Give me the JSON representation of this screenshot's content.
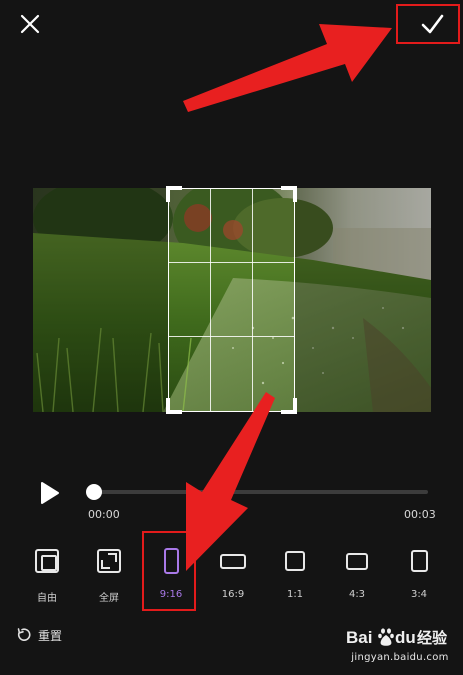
{
  "toolbar": {
    "close_icon": "close-icon",
    "confirm_icon": "check-icon"
  },
  "playback": {
    "start_time": "00:00",
    "end_time": "00:03",
    "progress": 0.0,
    "play_icon": "play-icon"
  },
  "ratios": [
    {
      "label": "自由",
      "icon": "free-crop-icon"
    },
    {
      "label": "全屏",
      "icon": "fullscreen-icon"
    },
    {
      "label": "9:16",
      "icon": "ratio-9-16-icon",
      "selected": true
    },
    {
      "label": "16:9",
      "icon": "ratio-16-9-icon"
    },
    {
      "label": "1:1",
      "icon": "ratio-1-1-icon"
    },
    {
      "label": "4:3",
      "icon": "ratio-4-3-icon"
    },
    {
      "label": "3:4",
      "icon": "ratio-3-4-icon"
    }
  ],
  "reset": {
    "label": "重置",
    "icon": "reset-icon"
  },
  "watermark": {
    "brand": "Baidu经验",
    "site": "jingyan.baidu.com"
  },
  "colors": {
    "accent": "#a979e8",
    "annotation": "#e31b1b",
    "background": "#141414"
  }
}
